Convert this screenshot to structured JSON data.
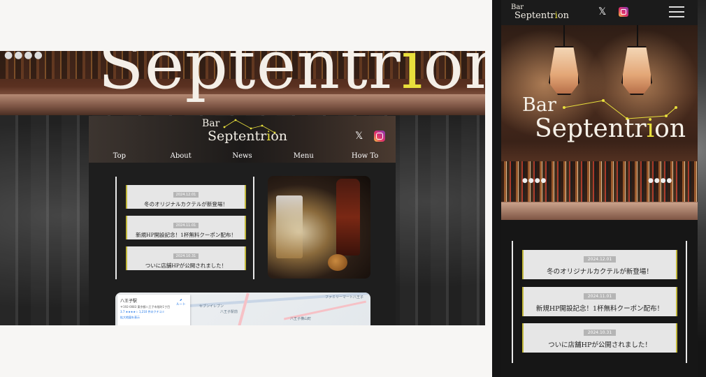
{
  "brand": {
    "bar": "Bar",
    "name_start": "Septentr",
    "name_i": "i",
    "name_end": "on",
    "accent": "#e8df3c"
  },
  "desktop": {
    "hero_start": "Septentr",
    "hero_i": "i",
    "hero_end": "on",
    "hero_dots": "●●●●",
    "nav": [
      "Top",
      "About",
      "News",
      "Menu",
      "How To"
    ],
    "social": {
      "x_icon": "𝕏"
    },
    "news": [
      {
        "date": "2024.12.01",
        "title": "冬のオリジナルカクテルが新登場！"
      },
      {
        "date": "2024.11.01",
        "title": "新規HP開設記念！1杯無料クーポン配布！"
      },
      {
        "date": "2024.10.31",
        "title": "ついに店舗HPが公開されました！"
      }
    ],
    "map": {
      "place": "八王子駅",
      "address": "〒192-0083 東京都八王子市旭町1丁目",
      "rating": "3.7 ★★★★☆  1,210 件のクチコミ",
      "more": "拡大地図を表示",
      "route": "ルート",
      "labels": [
        "ファミリーマート八王子",
        "セブンイレブン",
        "八王子駅前",
        "八王子横山町"
      ]
    }
  },
  "mobile": {
    "social": {
      "x_icon": "𝕏"
    },
    "hero_dots_left": "●●●●",
    "hero_dots_right": "●●●●",
    "news": [
      {
        "date": "2024.12.01",
        "title": "冬のオリジナルカクテルが新登場！"
      },
      {
        "date": "2024.11.01",
        "title": "新規HP開設記念！1杯無料クーポン配布！"
      },
      {
        "date": "2024.10.31",
        "title": "ついに店舗HPが公開されました！"
      }
    ]
  }
}
